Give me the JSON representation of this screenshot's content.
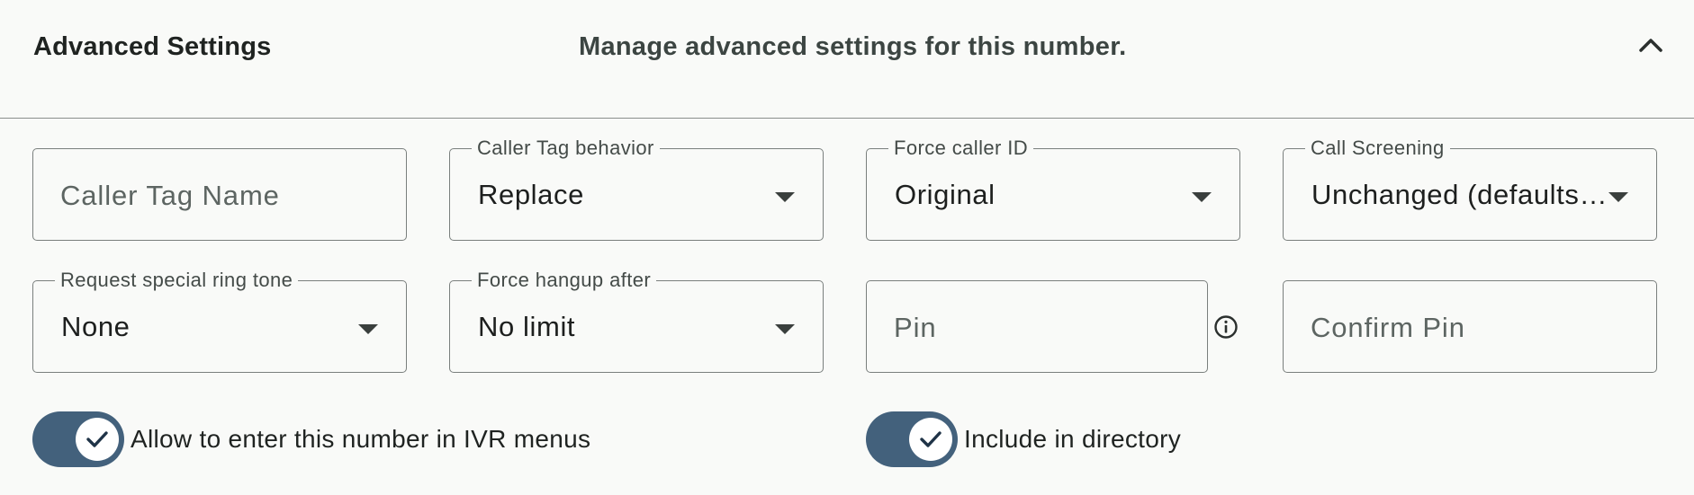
{
  "header": {
    "title": "Advanced Settings",
    "description": "Manage advanced settings for this number.",
    "collapse_icon": "chevron-up-icon"
  },
  "fields": {
    "caller_tag_name": {
      "placeholder": "Caller Tag Name",
      "value": ""
    },
    "caller_tag_behavior": {
      "label": "Caller Tag behavior",
      "value": "Replace"
    },
    "force_caller_id": {
      "label": "Force caller ID",
      "value": "Original"
    },
    "call_screening": {
      "label": "Call Screening",
      "value": "Unchanged (defaults…"
    },
    "special_ring_tone": {
      "label": "Request special ring tone",
      "value": "None"
    },
    "force_hangup_after": {
      "label": "Force hangup after",
      "value": "No limit"
    },
    "pin": {
      "placeholder": "Pin",
      "info_icon": "info-icon"
    },
    "confirm_pin": {
      "placeholder": "Confirm Pin"
    }
  },
  "toggles": {
    "ivr": {
      "label": "Allow to enter this number in IVR menus",
      "checked": true
    },
    "directory": {
      "label": "Include in directory",
      "checked": true
    }
  },
  "colors": {
    "switch_on": "#43617c",
    "background": "#f9faf8",
    "border": "#7a7f7d"
  }
}
